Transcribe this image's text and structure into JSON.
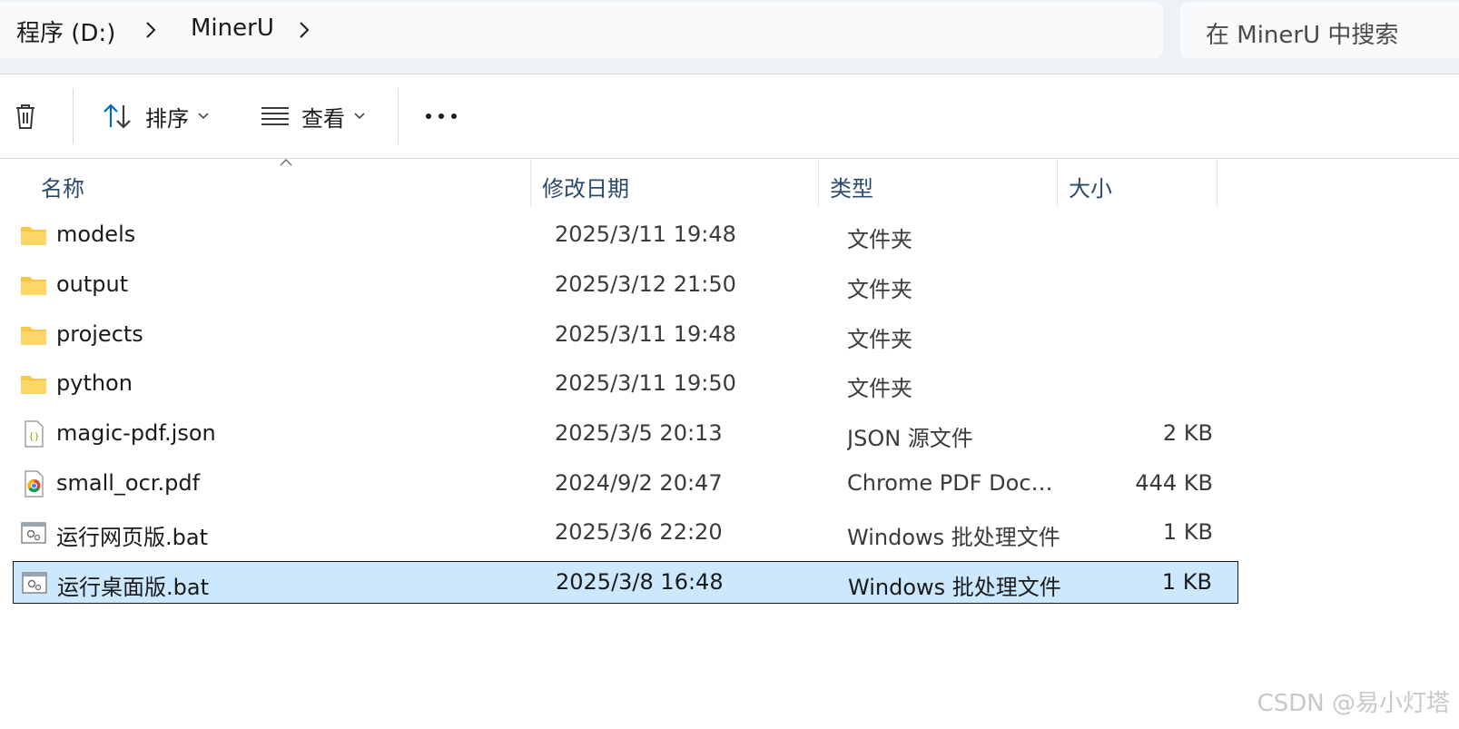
{
  "breadcrumb": {
    "items": [
      "程序 (D:)",
      "MinerU"
    ]
  },
  "search": {
    "placeholder": "在 MinerU 中搜索"
  },
  "toolbar": {
    "sort_label": "排序",
    "view_label": "查看"
  },
  "columns": {
    "name": "名称",
    "modified": "修改日期",
    "type": "类型",
    "size": "大小"
  },
  "files": [
    {
      "name": "models",
      "modified": "2025/3/11 19:48",
      "type": "文件夹",
      "size": "",
      "icon": "folder-icon"
    },
    {
      "name": "output",
      "modified": "2025/3/12 21:50",
      "type": "文件夹",
      "size": "",
      "icon": "folder-icon"
    },
    {
      "name": "projects",
      "modified": "2025/3/11 19:48",
      "type": "文件夹",
      "size": "",
      "icon": "folder-icon"
    },
    {
      "name": "python",
      "modified": "2025/3/11 19:50",
      "type": "文件夹",
      "size": "",
      "icon": "folder-icon"
    },
    {
      "name": "magic-pdf.json",
      "modified": "2025/3/5 20:13",
      "type": "JSON 源文件",
      "size": "2 KB",
      "icon": "json-file-icon"
    },
    {
      "name": "small_ocr.pdf",
      "modified": "2024/9/2 20:47",
      "type": "Chrome PDF Docu...",
      "size": "444 KB",
      "icon": "chrome-pdf-icon"
    },
    {
      "name": "运行网页版.bat",
      "modified": "2025/3/6 22:20",
      "type": "Windows 批处理文件",
      "size": "1 KB",
      "icon": "batch-file-icon"
    },
    {
      "name": "运行桌面版.bat",
      "modified": "2025/3/8 16:48",
      "type": "Windows 批处理文件",
      "size": "1 KB",
      "icon": "batch-file-icon",
      "selected": true
    }
  ],
  "watermark": "CSDN @易小灯塔",
  "colors": {
    "selection": "#cce8ff",
    "accent": "#0067c0",
    "folder": "#f8c745"
  }
}
